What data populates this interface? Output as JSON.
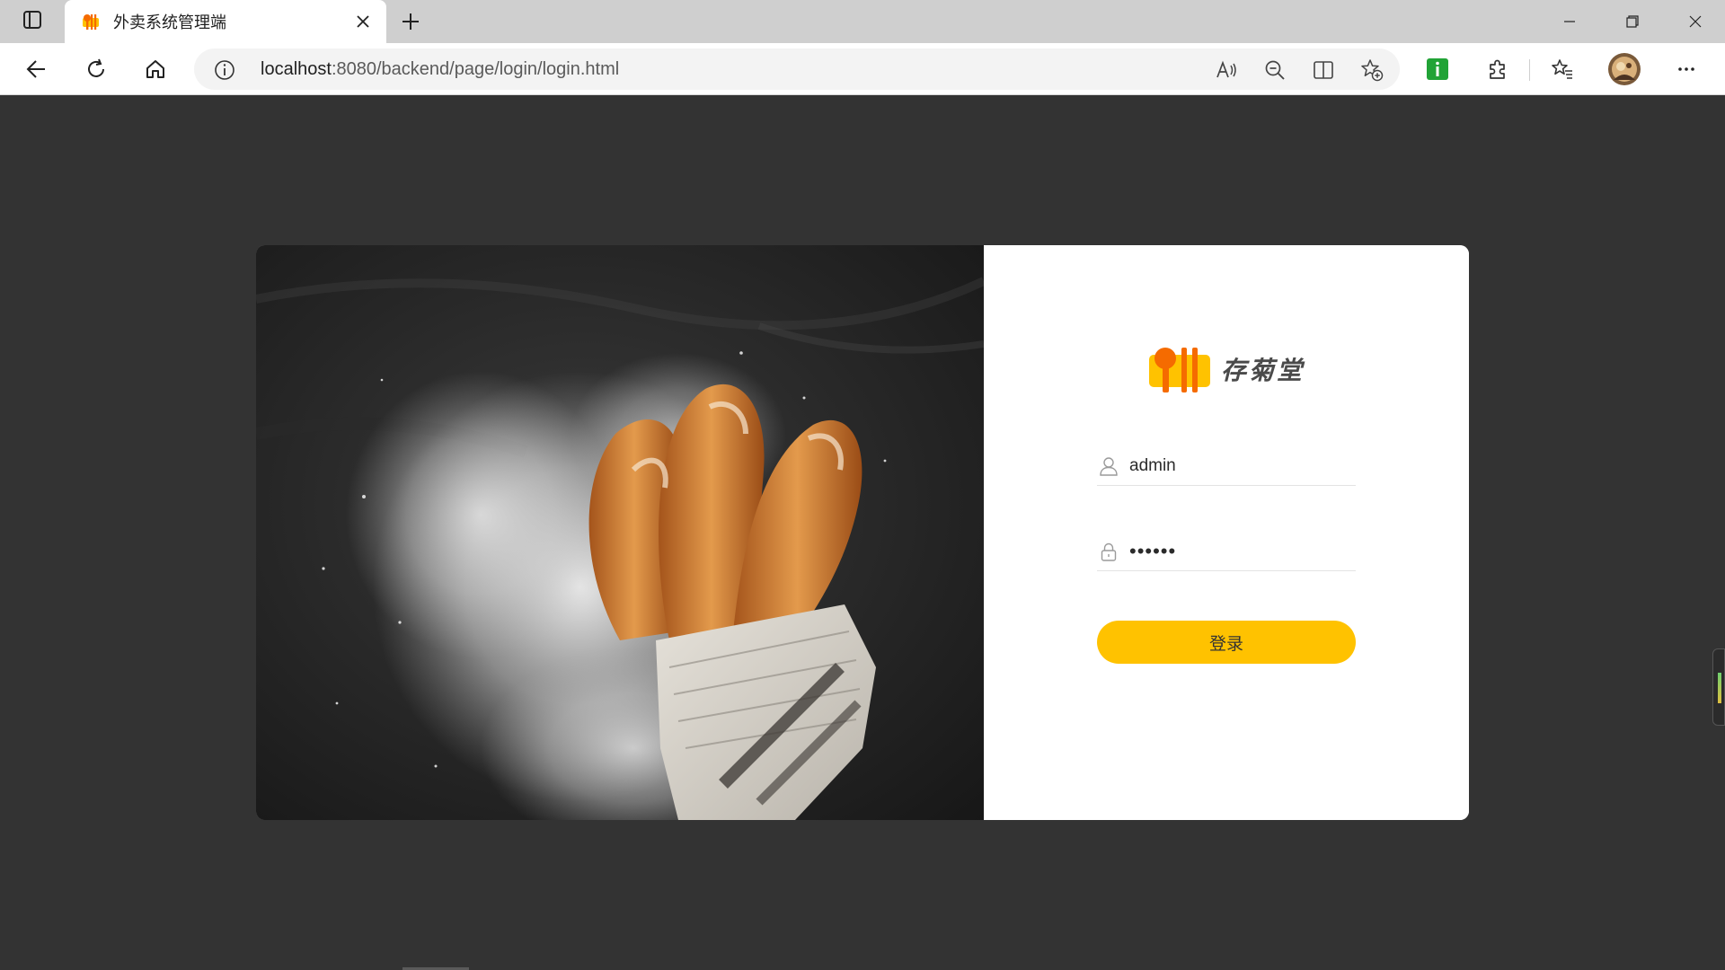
{
  "browser": {
    "tab": {
      "title": "外卖系统管理端",
      "favicon": "restaurant-logo-icon"
    },
    "address_bar": {
      "url_host": "localhost",
      "url_rest": ":8080/backend/page/login/login.html"
    },
    "toolbar_icons": [
      "back-icon",
      "refresh-icon",
      "home-icon",
      "site-info-icon",
      "read-aloud-icon",
      "zoom-out-icon",
      "split-screen-icon",
      "add-favorite-icon",
      "extension-green-icon",
      "extensions-icon",
      "favorites-icon",
      "profile-avatar",
      "more-menu-icon"
    ],
    "window_controls": [
      "minimize-icon",
      "restore-icon",
      "close-icon"
    ]
  },
  "login": {
    "brand_name": "存菊堂",
    "username": "admin",
    "password": "123456",
    "submit_label": "登录"
  },
  "colors": {
    "page_background": "#333333",
    "accent": "#ffc200",
    "logo_orange": "#f56b00",
    "logo_yellow": "#ffc200"
  }
}
